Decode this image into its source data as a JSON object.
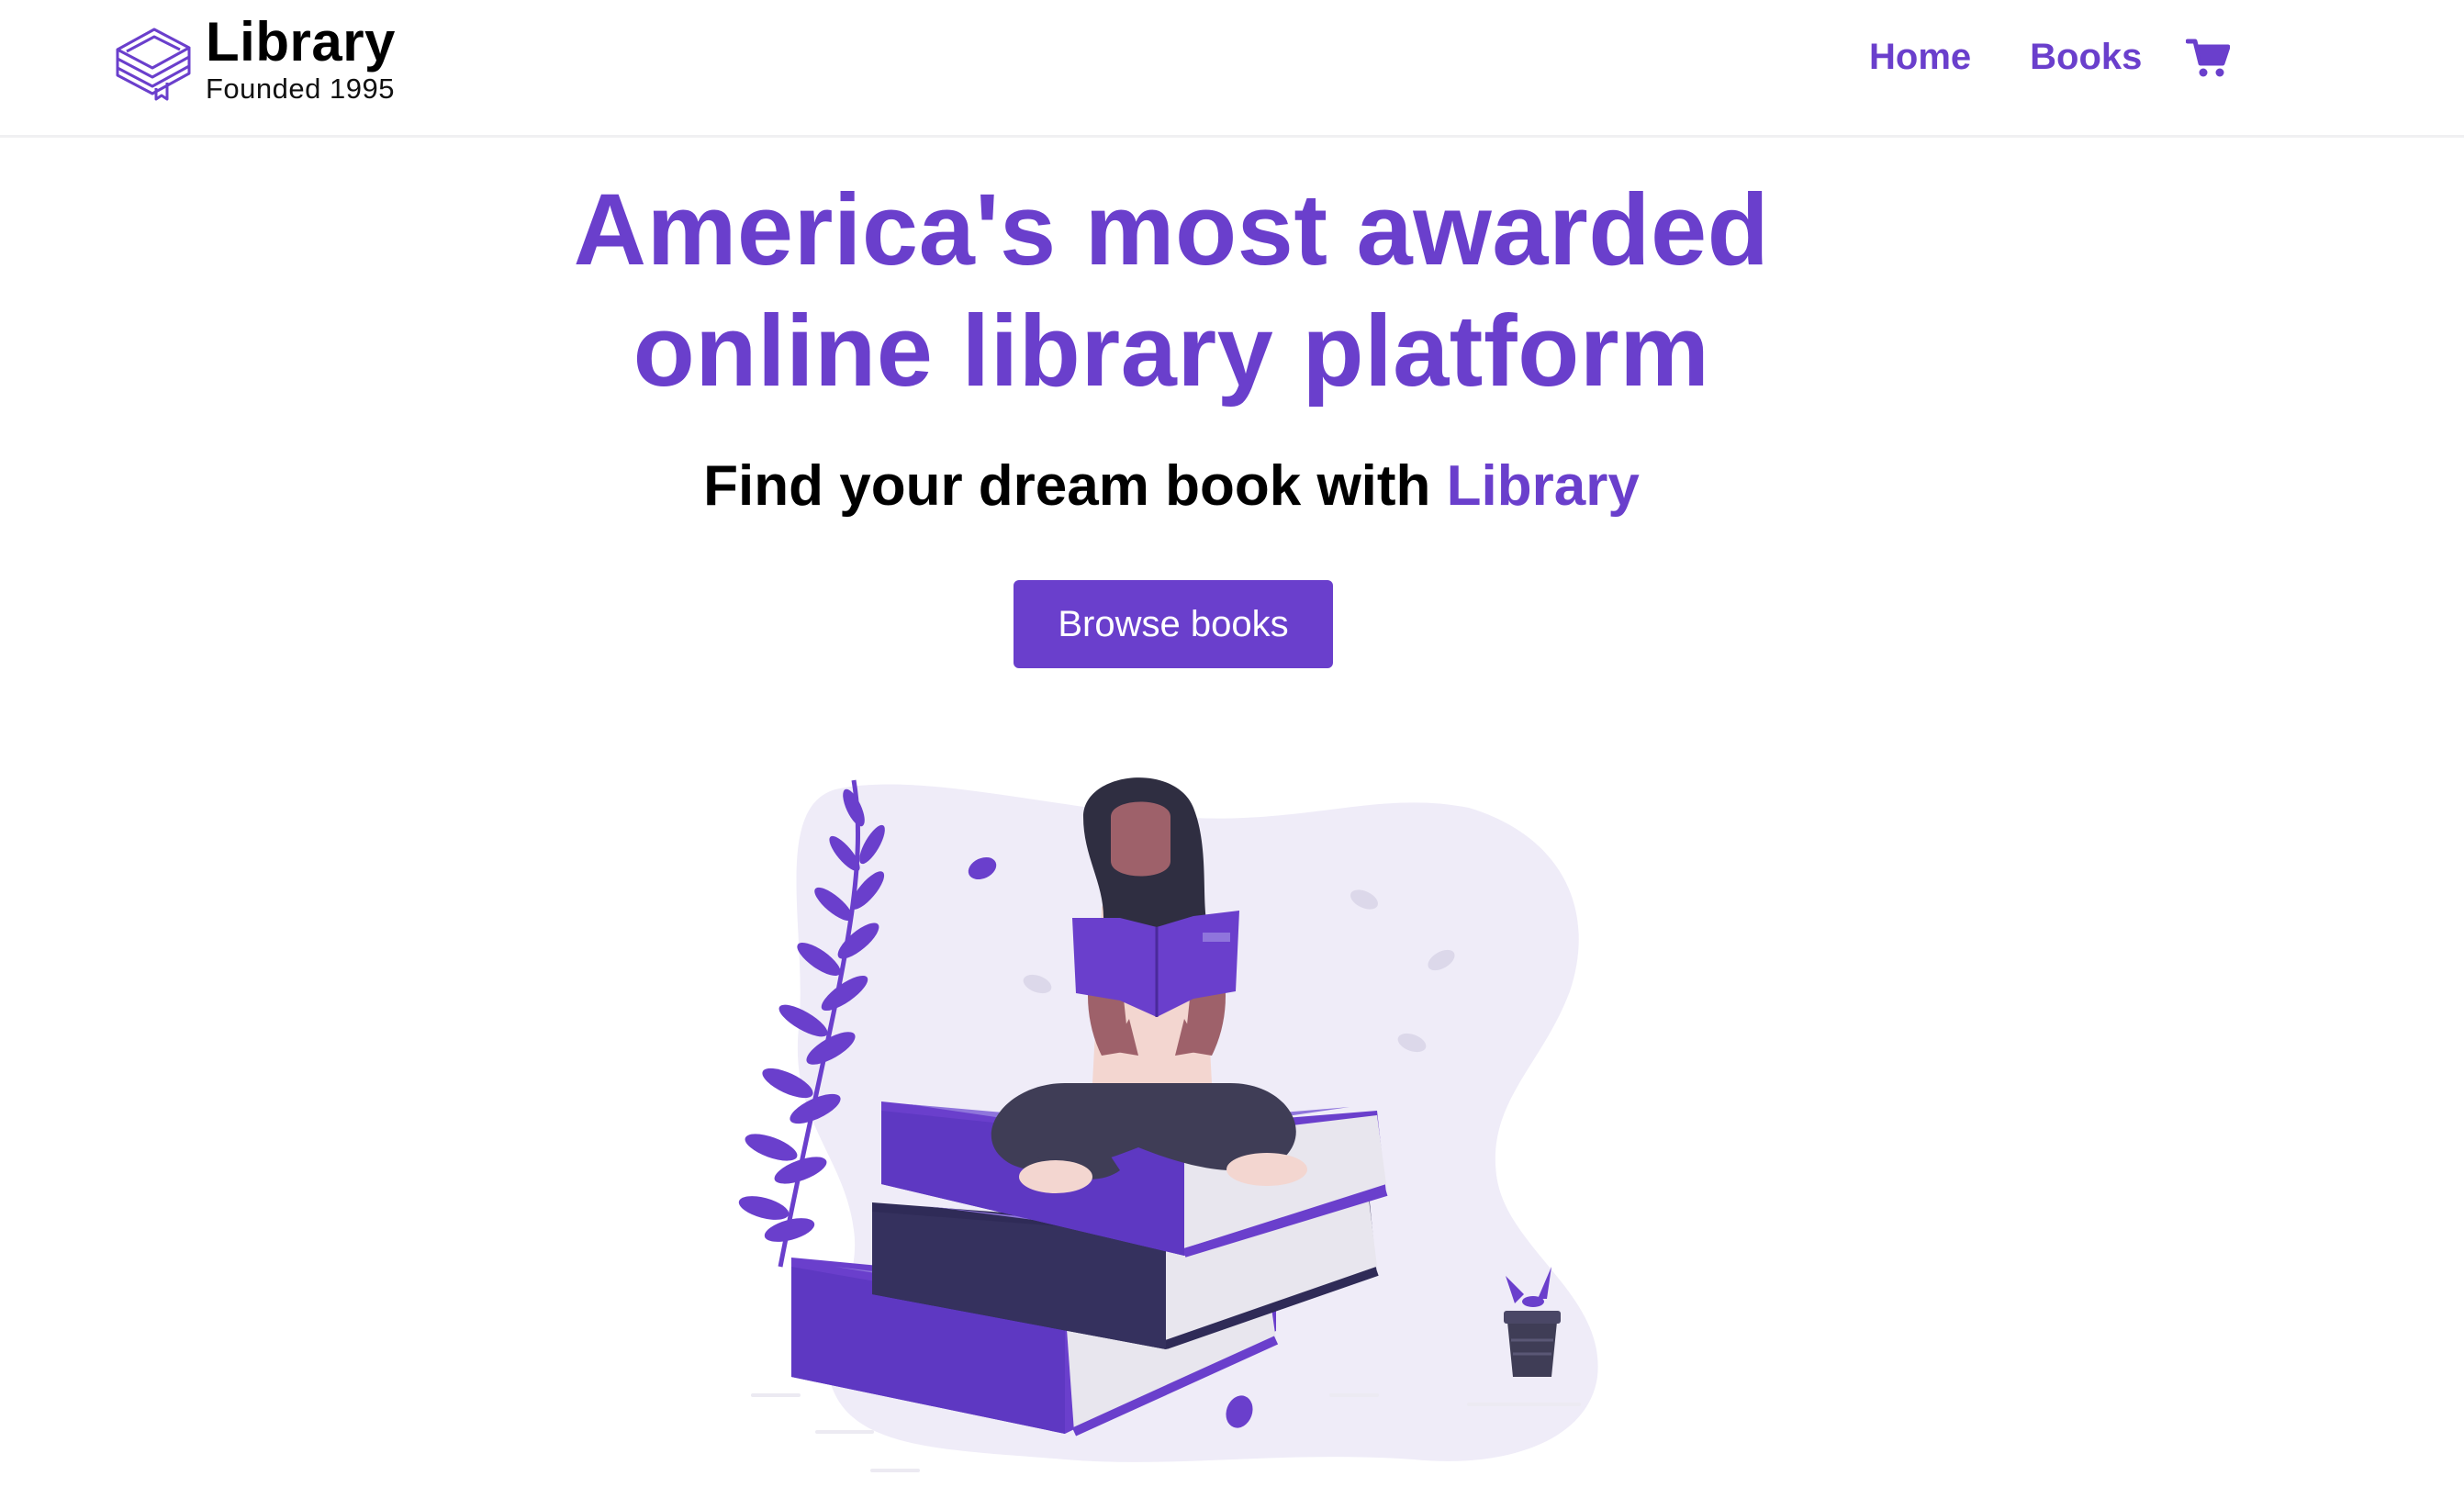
{
  "brand": {
    "title": "Library",
    "subtitle": "Founded 1995",
    "logo_icon": "stacked-books-icon"
  },
  "nav": {
    "links": [
      {
        "label": "Home"
      },
      {
        "label": "Books"
      }
    ],
    "cart_icon": "shopping-cart-icon"
  },
  "hero": {
    "title_line1": "America's most awarded",
    "title_line2": "online library platform",
    "subtitle_prefix": "Find your dream book with ",
    "subtitle_accent": "Library",
    "cta_label": "Browse books"
  },
  "illustration": {
    "icon": "woman-reading-on-books-illustration"
  },
  "colors": {
    "accent": "#6a3fcc",
    "text": "#000000",
    "background": "#ffffff",
    "blob": "#efecf8"
  }
}
